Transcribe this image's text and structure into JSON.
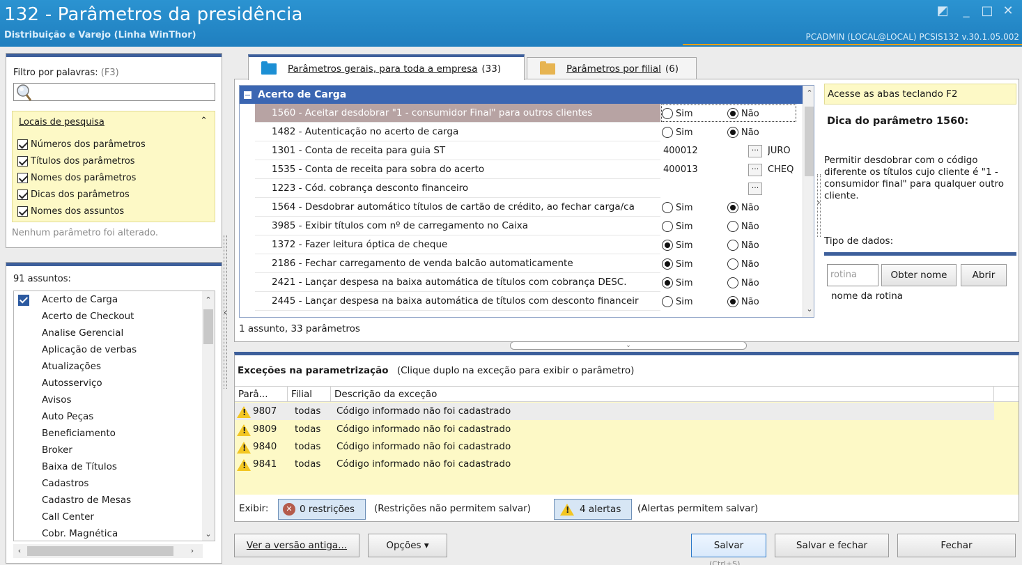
{
  "window": {
    "title": "132 - Parâmetros da presidência",
    "subtitle": "Distribuição e Varejo (Linha WinThor)",
    "status": "PCADMIN (LOCAL@LOCAL)   PCSIS132  v.30.1.05.002"
  },
  "filter": {
    "label": "Filtro por palavras:",
    "shortcut": "(F3)",
    "input_value": "",
    "locations_title": "Locais de pesquisa",
    "options": [
      {
        "label": "Números dos parâmetros",
        "checked": true
      },
      {
        "label": "Títulos dos parâmetros",
        "checked": true
      },
      {
        "label": "Nomes dos parâmetros",
        "checked": true
      },
      {
        "label": "Dicas dos parâmetros",
        "checked": true
      },
      {
        "label": "Nomes dos assuntos",
        "checked": true
      }
    ],
    "no_change": "Nenhum parâmetro foi alterado."
  },
  "subjects": {
    "count_label": "91 assuntos:",
    "items": [
      "Acerto de Carga",
      "Acerto de Checkout",
      "Analise Gerencial",
      "Aplicação de verbas",
      "Atualizações",
      "Autosserviço",
      "Avisos",
      "Auto Peças",
      "Beneficiamento",
      "Broker",
      "Baixa de Títulos",
      "Cadastros",
      "Cadastro de Mesas",
      "Call Center",
      "Cobr. Magnética"
    ]
  },
  "tabs": [
    {
      "label": "Parâmetros gerais, para toda a empresa",
      "count": "(33)",
      "active": true
    },
    {
      "label": "Parâmetros por filial",
      "count": "(6)",
      "active": false
    }
  ],
  "grid": {
    "group": "Acerto de Carga",
    "rows": [
      {
        "name": "1560 - Aceitar desdobrar \"1 - consumidor Final\" para outros clientes",
        "type": "bool",
        "value": "Não"
      },
      {
        "name": "1482 - Autenticação no acerto de carga",
        "type": "bool",
        "value": "Não"
      },
      {
        "name": "1301 - Conta de receita para guia ST",
        "type": "code",
        "code": "400012",
        "desc": "JURO"
      },
      {
        "name": "1535 - Conta de receita para sobra do acerto",
        "type": "code",
        "code": "400013",
        "desc": "CHEQ"
      },
      {
        "name": "1223 - Cód. cobrança desconto financeiro",
        "type": "code",
        "code": "",
        "desc": ""
      },
      {
        "name": "1564 - Desdobrar automático títulos de cartão de crédito, ao fechar carga/ca",
        "type": "bool",
        "value": "Não"
      },
      {
        "name": "3985 - Exibir títulos com nº de carregamento no Caixa",
        "type": "bool",
        "value": "none"
      },
      {
        "name": "1372 - Fazer leitura óptica de cheque",
        "type": "bool",
        "value": "Sim"
      },
      {
        "name": "2186 - Fechar carregamento de venda balcão automaticamente",
        "type": "bool",
        "value": "Sim"
      },
      {
        "name": "2421 - Lançar despesa na baixa automática de títulos com cobrança DESC.",
        "type": "bool",
        "value": "Sim"
      },
      {
        "name": "2445 - Lançar despesa na baixa automática de títulos com desconto financeir",
        "type": "bool",
        "value": "Não"
      }
    ],
    "yes": "Sim",
    "no": "Não",
    "ellipsis": "···",
    "summary": "1 assunto, 33 parâmetros"
  },
  "hint": {
    "f2": "Acesse as abas teclando F2",
    "title": "Dica do parâmetro 1560:",
    "text": "Permitir desdobrar com o código diferente os títulos cujo cliente é \"1 - consumidor final\" para qualquer outro cliente.",
    "type_label": "Tipo de dados:"
  },
  "routine": {
    "placeholder": "rotina",
    "get_name": "Obter nome",
    "open": "Abrir",
    "name_label": "nome da rotina"
  },
  "exceptions": {
    "title": "Exceções na parametrização",
    "subtitle": "(Clique duplo na exceção para exibir o parâmetro)",
    "columns": [
      "Parâ...",
      "Filial",
      "Descrição da exceção"
    ],
    "rows": [
      {
        "code": "9807",
        "branch": "todas",
        "desc": "Código informado não foi cadastrado"
      },
      {
        "code": "9809",
        "branch": "todas",
        "desc": "Código informado não foi cadastrado"
      },
      {
        "code": "9840",
        "branch": "todas",
        "desc": "Código informado não foi cadastrado"
      },
      {
        "code": "9841",
        "branch": "todas",
        "desc": "Código informado não foi cadastrado"
      }
    ],
    "show_label": "Exibir:",
    "restrictions_btn": "0 restrições",
    "restrictions_note": "(Restrições não permitem salvar)",
    "alerts_btn": "4 alertas",
    "alerts_note": "(Alertas permitem salvar)"
  },
  "buttons": {
    "old_version": "Ver a versão antiga...",
    "options": "Opções ▾",
    "save": "Salvar",
    "save_hint": "(Ctrl+S)",
    "save_close": "Salvar e fechar",
    "close": "Fechar"
  }
}
